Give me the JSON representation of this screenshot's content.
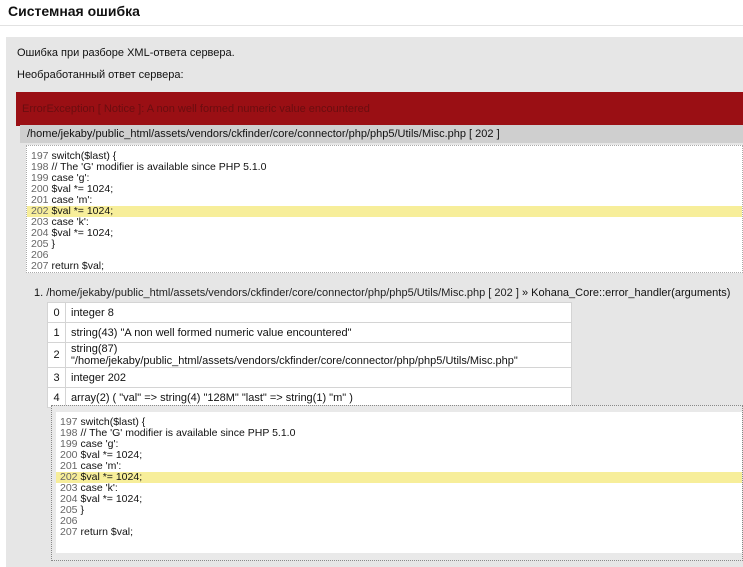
{
  "header": {
    "title": "Системная ошибка"
  },
  "messages": {
    "parse_error": "Ошибка при разборе XML-ответа сервера.",
    "raw_response_label": "Необработанный ответ сервера:"
  },
  "error": {
    "text": "ErrorException [ Notice ]: A non well formed numeric value encountered"
  },
  "file": {
    "location": "/home/jekaby/public_html/assets/vendors/ckfinder/core/connector/php/php5/Utils/Misc.php [ 202 ]"
  },
  "source1": [
    {
      "no": "197",
      "code": "switch($last) {"
    },
    {
      "no": "198",
      "code": "// The 'G' modifier is available since PHP 5.1.0"
    },
    {
      "no": "199",
      "code": "case 'g':"
    },
    {
      "no": "200",
      "code": "$val *= 1024;"
    },
    {
      "no": "201",
      "code": "case 'm':"
    },
    {
      "no": "202",
      "code": "$val *= 1024;"
    },
    {
      "no": "203",
      "code": "case 'k':"
    },
    {
      "no": "204",
      "code": "$val *= 1024;"
    },
    {
      "no": "205",
      "code": "}"
    },
    {
      "no": "206",
      "code": ""
    },
    {
      "no": "207",
      "code": "return $val;"
    }
  ],
  "highlight_line": "202",
  "trace": {
    "number": "1.",
    "path": "/home/jekaby/public_html/assets/vendors/ckfinder/core/connector/php/php5/Utils/Misc.php [ 202 ]",
    "call": "» Kohana_Core::error_handler(arguments)"
  },
  "args": [
    {
      "idx": "0",
      "val": "integer 8"
    },
    {
      "idx": "1",
      "val": "string(43) \"A non well formed numeric value encountered\""
    },
    {
      "idx": "2",
      "val": "string(87) \"/home/jekaby/public_html/assets/vendors/ckfinder/core/connector/php/php5/Utils/Misc.php\""
    },
    {
      "idx": "3",
      "val": "integer 202"
    },
    {
      "idx": "4",
      "val": "array(2) ( \"val\" => string(4) \"128M\" \"last\" => string(1) \"m\" )"
    }
  ],
  "source2": [
    {
      "no": "197",
      "code": "switch($last) {"
    },
    {
      "no": "198",
      "code": "// The 'G' modifier is available since PHP 5.1.0"
    },
    {
      "no": "199",
      "code": "case 'g':"
    },
    {
      "no": "200",
      "code": "$val *= 1024;"
    },
    {
      "no": "201",
      "code": "case 'm':"
    },
    {
      "no": "202",
      "code": "$val *= 1024;"
    },
    {
      "no": "203",
      "code": "case 'k':"
    },
    {
      "no": "204",
      "code": "$val *= 1024;"
    },
    {
      "no": "205",
      "code": "}"
    },
    {
      "no": "206",
      "code": ""
    },
    {
      "no": "207",
      "code": "return $val;"
    }
  ]
}
